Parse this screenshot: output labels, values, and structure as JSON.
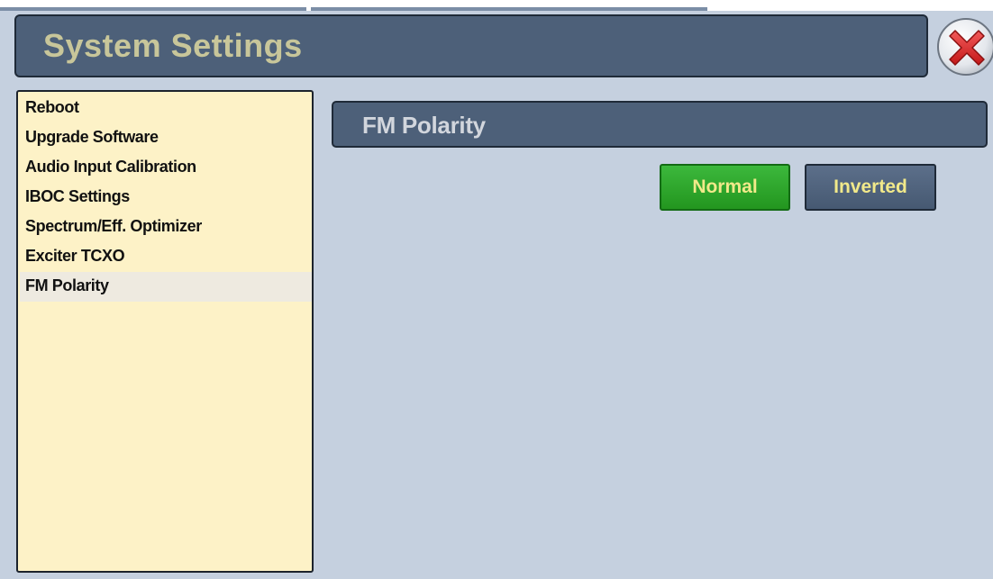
{
  "window": {
    "title": "System Settings",
    "close_icon": "close-icon"
  },
  "sidebar": {
    "items": [
      {
        "label": "Reboot",
        "selected": false
      },
      {
        "label": "Upgrade Software",
        "selected": false
      },
      {
        "label": "Audio Input Calibration",
        "selected": false
      },
      {
        "label": "IBOC Settings",
        "selected": false
      },
      {
        "label": "Spectrum/Eff. Optimizer",
        "selected": false
      },
      {
        "label": "Exciter TCXO",
        "selected": false
      },
      {
        "label": "FM Polarity",
        "selected": true
      }
    ]
  },
  "main": {
    "section_title": "FM Polarity",
    "options": [
      {
        "label": "Normal",
        "active": true
      },
      {
        "label": "Inverted",
        "active": false
      }
    ]
  },
  "colors": {
    "panel_bg": "#c5d0df",
    "header_bg": "#4d6079",
    "title_text": "#c8c69a",
    "sidebar_bg": "#fdf2c7",
    "active_button": "#2aa52a",
    "inactive_button": "#52657f",
    "button_text": "#f1e98a"
  }
}
